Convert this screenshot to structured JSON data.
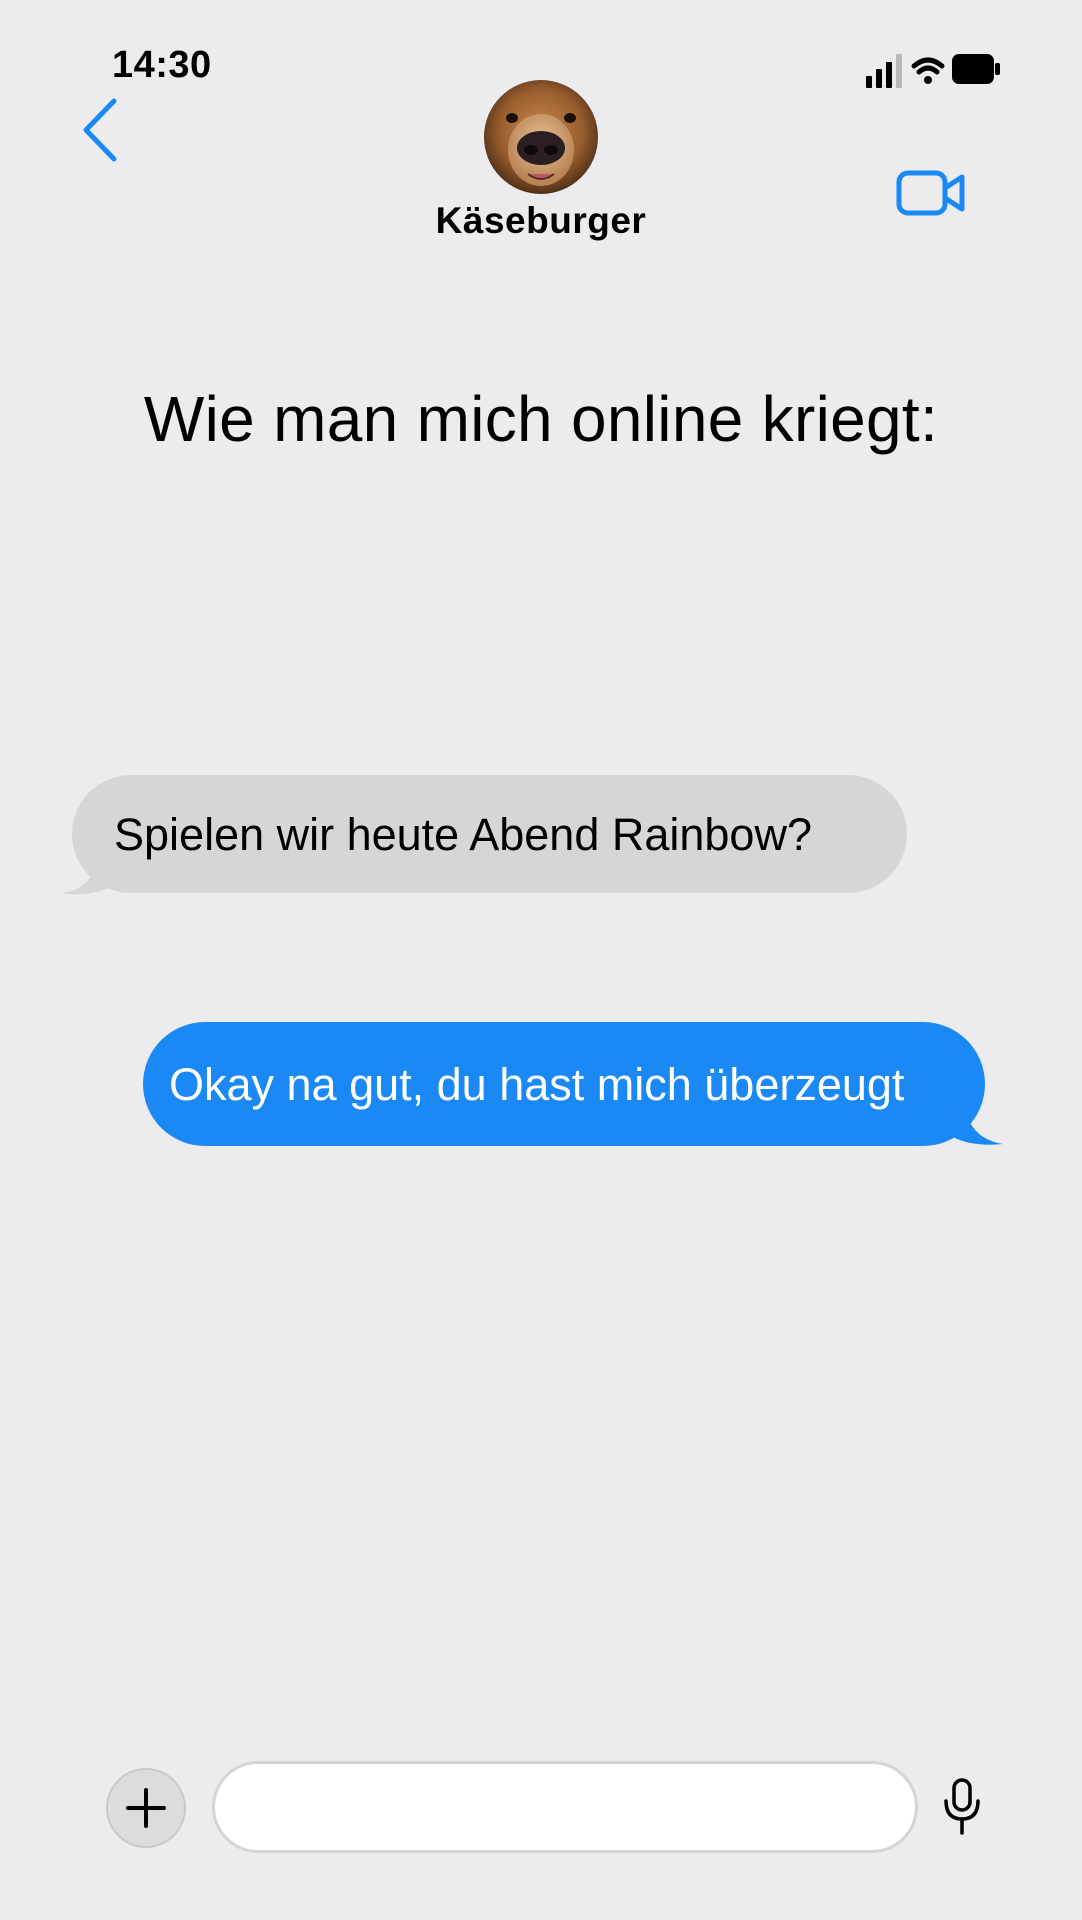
{
  "status_bar": {
    "time": "14:30",
    "icons": [
      "cellular-signal-icon",
      "wifi-icon",
      "battery-icon"
    ]
  },
  "header": {
    "contact_name": "Käseburger",
    "back_icon": "chevron-left-icon",
    "video_icon": "video-camera-icon",
    "avatar": "bear-face-photo"
  },
  "caption": "Wie man mich online kriegt:",
  "messages": [
    {
      "direction": "incoming",
      "text": "Spielen wir heute Abend Rainbow?"
    },
    {
      "direction": "outgoing",
      "text": "Okay na gut, du hast mich überzeugt"
    }
  ],
  "composer": {
    "input_value": "",
    "plus_icon": "plus-icon",
    "mic_icon": "microphone-icon"
  },
  "colors": {
    "background": "#ececee",
    "accent": "#1a88f5",
    "incoming_bubble": "#d6d6d8",
    "outgoing_bubble": "#1a88f5"
  }
}
